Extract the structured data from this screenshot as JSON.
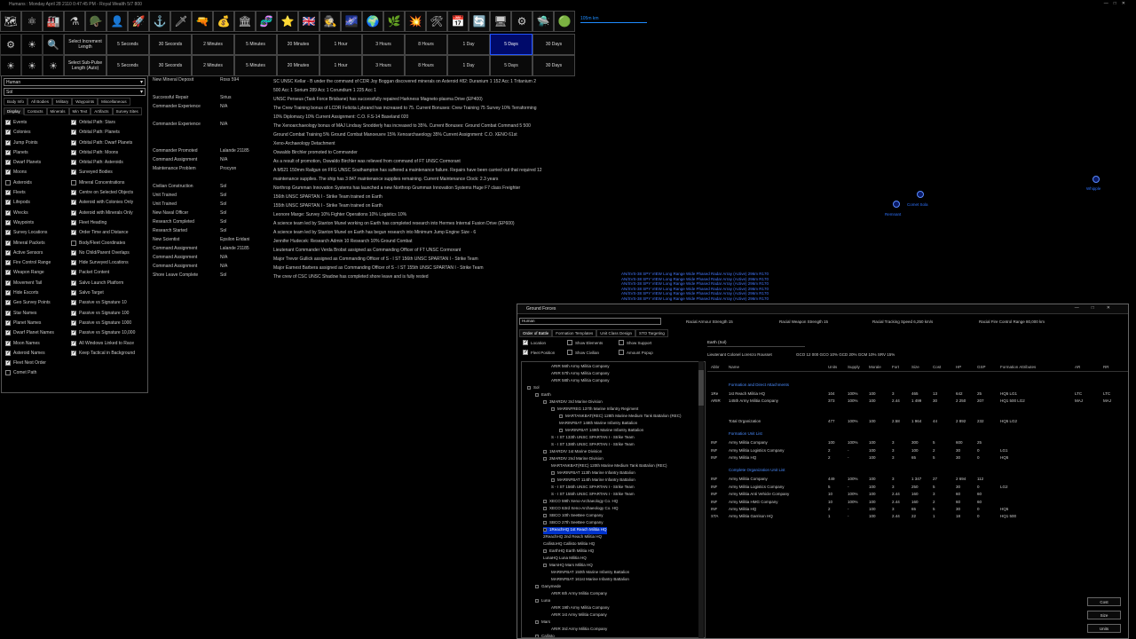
{
  "title": "Humans : Monday April 28 2110 0:47:45 PM - Royal Wealth 5/7 800",
  "window_controls": [
    "—",
    "□",
    "✕"
  ],
  "toolbar_icons": [
    "system-map-icon",
    "galaxy-icon",
    "production-icon",
    "research-icon",
    "ground-forces-icon",
    "commanders-icon",
    "ship-class-icon",
    "fleet-icon",
    "missile-icon",
    "turret-icon",
    "wealth-icon",
    "race-icon",
    "species-icon",
    "medal-icon",
    "nation-flag-icon",
    "intelligence-icon",
    "galaxy-view-icon",
    "survey-icon",
    "environment-icon",
    "combat-icon",
    "hull-icon",
    "events-icon",
    "refresh-icon",
    "tech-icon",
    "settings-icon",
    "ship-icon",
    "globe-icon"
  ],
  "toolbar_glyphs": [
    "🗺",
    "⚛",
    "🏭",
    "⚗",
    "🪖",
    "👤",
    "🚀",
    "⚓",
    "🗡",
    "🔫",
    "💰",
    "🏛",
    "🧬",
    "⭐",
    "🇬🇧",
    "🕵",
    "🌌",
    "🌍",
    "🌿",
    "💥",
    "🛠",
    "📅",
    "🔄",
    "🖥",
    "⚙",
    "🛸",
    "🟢"
  ],
  "scale_label": "105m km",
  "time_rows": [
    {
      "icons": [
        "⚙",
        "☀",
        "🔍"
      ],
      "select_label": "Select Increment Length",
      "buttons": [
        "5 Seconds",
        "30 Seconds",
        "2 Minutes",
        "5 Minutes",
        "20 Minutes",
        "1 Hour",
        "3 Hours",
        "8 Hours",
        "1 Day",
        "5 Days",
        "30 Days"
      ],
      "active_index": 9
    },
    {
      "icons": [
        "☀",
        "☀",
        "☀"
      ],
      "select_label": "Select Sub-Pulse Length (Auto)",
      "buttons": [
        "5 Seconds",
        "30 Seconds",
        "2 Minutes",
        "5 Minutes",
        "20 Minutes",
        "1 Hour",
        "3 Hours",
        "8 Hours",
        "1 Day",
        "5 Days",
        "30 Days"
      ],
      "active_index": -1
    }
  ],
  "left_panel": {
    "race_select": "Human",
    "system_select": "Sol",
    "tabs_row1": [
      "Body Info",
      "All Bodies",
      "Military",
      "Waypoints",
      "Miscellaneous"
    ],
    "tabs_row2": [
      "Display",
      "Contacts",
      "Minerals",
      "Min Text",
      "Artifacts",
      "Survey Sites"
    ],
    "checks_left": [
      {
        "label": "Events",
        "on": true
      },
      {
        "label": "Colonies",
        "on": true
      },
      {
        "label": "Jump Points",
        "on": true
      },
      {
        "label": "Planets",
        "on": true
      },
      {
        "label": "Dwarf Planets",
        "on": true
      },
      {
        "label": "Moons",
        "on": true
      },
      {
        "label": "Asteroids",
        "on": false
      },
      {
        "label": "Fleets",
        "on": true
      },
      {
        "label": "Lifepods",
        "on": true
      },
      {
        "label": "Wrecks",
        "on": true
      },
      {
        "label": "Waypoints",
        "on": true
      },
      {
        "label": "Survey Locations",
        "on": true
      },
      {
        "label": "Mineral Packets",
        "on": true
      },
      {
        "label": "Active Sensors",
        "on": true
      },
      {
        "label": "Fire Control Range",
        "on": true
      },
      {
        "label": "Weapon Range",
        "on": true
      },
      {
        "label": "Movement Tail",
        "on": true
      },
      {
        "label": "Hide Escorts",
        "on": true
      },
      {
        "label": "Geo Survey Points",
        "on": true
      },
      {
        "label": "Star Names",
        "on": true
      },
      {
        "label": "Planet Names",
        "on": true
      },
      {
        "label": "Dwarf Planet Names",
        "on": true
      },
      {
        "label": "Moon Names",
        "on": true
      },
      {
        "label": "Asteroid Names",
        "on": true
      },
      {
        "label": "Fleet Next Order",
        "on": true
      },
      {
        "label": "Comet Path",
        "on": false
      }
    ],
    "checks_right": [
      {
        "label": "Orbital Path: Stars",
        "on": true
      },
      {
        "label": "Orbital Path: Planets",
        "on": true
      },
      {
        "label": "Orbital Path: Dwarf Planets",
        "on": true
      },
      {
        "label": "Orbital Path: Moons",
        "on": true
      },
      {
        "label": "Orbital Path: Asteroids",
        "on": true
      },
      {
        "label": "Surveyed Bodies",
        "on": true
      },
      {
        "label": "Mineral Concentrations",
        "on": false
      },
      {
        "label": "Centre on Selected Objects",
        "on": true
      },
      {
        "label": "Asteroid with Colonies Only",
        "on": true
      },
      {
        "label": "Asteroid with Minerals Only",
        "on": true
      },
      {
        "label": "Fleet Heading",
        "on": true
      },
      {
        "label": "Order Time and Distance",
        "on": true
      },
      {
        "label": "Body/Fleet Coordinates",
        "on": false
      },
      {
        "label": "No Child/Parent Overlaps",
        "on": true
      },
      {
        "label": "Hide Surveyed Locations",
        "on": true
      },
      {
        "label": "Packet Content",
        "on": true
      },
      {
        "label": "Salvo Launch Platform",
        "on": true
      },
      {
        "label": "Salvo Target",
        "on": true
      },
      {
        "label": "Passive vs Signature 10",
        "on": true
      },
      {
        "label": "Passive vs Signature 100",
        "on": true
      },
      {
        "label": "Passive vs Signature 1000",
        "on": true
      },
      {
        "label": "Passive vs Signature 10,000",
        "on": true
      },
      {
        "label": "All Windows Linked to Race",
        "on": true
      },
      {
        "label": "Keep Tactical in Background",
        "on": true
      }
    ]
  },
  "events": [
    {
      "type": "New Mineral Deposit",
      "loc": "Ross 594",
      "lines": [
        "SC UNSC Kellar - B under the command of CDR Joy Boggan discovered minerals on Asteroid #82:  Duranium  1 152  Acc 1    Tritanium  2",
        "500  Acc 1    Sorium  289  Acc 1    Corundium  1 225  Acc 1"
      ]
    },
    {
      "type": "Successful Repair",
      "loc": "Sirius",
      "lines": [
        "UNSC Perseus (Task Force Brisbane) has successfully repaired Harkness Magneto-plasma Drive (EP400)"
      ]
    },
    {
      "type": "Commander Experience",
      "loc": "N/A",
      "lines": [
        "The Crew Training bonus of LCDR Felicita Lybrand has increased to 75.   Current Bonuses:  Crew Training 75    Survey 10%    Terraforming",
        "10%    Diplomacy 10%    Current Assignment:  C.O. F.S-14 Baseland 020"
      ]
    },
    {
      "type": "Commander Experience",
      "loc": "N/A",
      "lines": [
        "The Xenoarchaeology bonus of MAJ Lindsay Snodderly has increased to 35%.   Current Bonuses:  Ground Combat Command 5 500",
        "Ground Combat Training 5%    Ground Combat Manoeuvre 15%    Xenoarchaeology 35%    Current Assignment:  C.O. XENO 61st",
        "Xeno-Archaeology Detachment"
      ]
    },
    {
      "type": "Commander Promoted",
      "loc": "Lalande 21185",
      "lines": [
        "Oswaldo Birchler promoted to Commander"
      ]
    },
    {
      "type": "Command Assignment",
      "loc": "N/A",
      "lines": [
        "As a result of promotion, Oswaldo Birchler was relieved from command of FT UNSC Cormorant"
      ]
    },
    {
      "type": "Maintenance Problem",
      "loc": "Procyon",
      "lines": [
        "A M521 150mm Railgun on FFG UNSC Southampton has suffered a maintenance failure. Repairs have been carried out that required 12",
        "maintenance supplies. The ship has 3 847 maintenance supplies remaining. Current Maintenance Clock: 2.3 years"
      ]
    },
    {
      "type": "Civilian Construction",
      "loc": "Sol",
      "lines": [
        "Northrop Grumman Innovation Systems has launched a new Northrop Grumman Innovation Systems Huge F7 class Freighter"
      ]
    },
    {
      "type": "Unit Trained",
      "loc": "Sol",
      "lines": [
        "156th UNSC SPARTAN I - Strike Team trained on Earth"
      ]
    },
    {
      "type": "Unit Trained",
      "loc": "Sol",
      "lines": [
        "155th UNSC SPARTAN I - Strike Team trained on Earth"
      ]
    },
    {
      "type": "New Naval Officer",
      "loc": "Sol",
      "lines": [
        "Leonore Marge:  Survey 10%    Fighter Operations 10%    Logistics 10%"
      ]
    },
    {
      "type": "Research Completed",
      "loc": "Sol",
      "lines": [
        "A science team led by Stanton Munel working on Earth has completed research into Hermes Internal Fusion Drive  (EP600)"
      ]
    },
    {
      "type": "Research Started",
      "loc": "Sol",
      "lines": [
        "A science team led by Stanton Munel on Earth has begun research into Minimum Jump Engine Size - 6"
      ]
    },
    {
      "type": "New Scientist",
      "loc": "Epsilon Eridani",
      "lines": [
        "Jennifer Hudecek:  Research Admin 10    Research 10%    Ground Combat"
      ]
    },
    {
      "type": "Command Assignment",
      "loc": "Lalande 21185",
      "lines": [
        "Lieutenant Commander Verda Brobst assigned as Commanding Officer of FT UNSC Cormorant"
      ]
    },
    {
      "type": "Command Assignment",
      "loc": "N/A",
      "lines": [
        "Major Trevor Gullick assigned as Commanding Officer of S - I ST 156th UNSC SPARTAN I - Strike Team"
      ]
    },
    {
      "type": "Command Assignment",
      "loc": "N/A",
      "lines": [
        "Major Earnest Barbera assigned as Commanding Officer of S - I ST 155th UNSC SPARTAN I - Strike Team"
      ]
    },
    {
      "type": "Shore Leave Complete",
      "loc": "Sol",
      "lines": [
        "The crew of CSC UNSC Shadow has completed shore leave and is fully rested"
      ]
    }
  ],
  "map": {
    "bodies": [
      {
        "label": "Comet Sola"
      },
      {
        "label": "Remnant"
      },
      {
        "label": "Whipple"
      }
    ],
    "radar": [
      "AN/SVS-38 SPY VIEW Long Range Wide Phased Radar Array (Active)  296m  R170",
      "AN/SVS-38 SPY VIEW Long Range Wide Phased Radar Array (Active)  296m  R170",
      "AN/SVS-38 SPY VIEW Long Range Wide Phased Radar Array (Active)  296m  R170",
      "AN/SVS-38 SPY VIEW Long Range Wide Phased Radar Array (Active)  296m  R170",
      "AN/SVS-38 SPY VIEW Long Range Wide Phased Radar Array (Active)  296m  R170",
      "AN/SVS-38 SPY VIEW Long Range Wide Phased Radar Array (Active)  296m  R170"
    ]
  },
  "ground_forces": {
    "title": "Ground Forces",
    "race": "Human",
    "stats": [
      {
        "label": "Racial Armour Strength",
        "value": "15"
      },
      {
        "label": "Racial Weapon Strength",
        "value": "15"
      },
      {
        "label": "Racial Tracking Speed",
        "value": "6,250 km/s"
      },
      {
        "label": "Racial Fire Control Range",
        "value": "80,000 km"
      }
    ],
    "tabs": [
      "Order of Battle",
      "Formation Templates",
      "Unit Class Design",
      "STO Targeting"
    ],
    "options": [
      {
        "label": "Location",
        "on": true
      },
      {
        "label": "Show Elements",
        "on": false
      },
      {
        "label": "Show Support",
        "on": false
      },
      {
        "label": "Fleet Position",
        "on": true
      },
      {
        "label": "Show Civilian",
        "on": false
      },
      {
        "label": "Amount Popup",
        "on": false
      }
    ],
    "tree": [
      {
        "t": "ARIR 56th Army Militia Company",
        "d": 3
      },
      {
        "t": "ARIR 57th Army Militia Company",
        "d": 3
      },
      {
        "t": "ARIR 58th Army Militia Company",
        "d": 3
      },
      {
        "t": "Sol",
        "d": 0,
        "box": true
      },
      {
        "t": "Earth",
        "d": 1,
        "box": true
      },
      {
        "t": "3MARDIV 3rd Marine Division",
        "d": 2,
        "box": true
      },
      {
        "t": "MARINFREG 137th Marine Infantry Regiment",
        "d": 3,
        "box": true
      },
      {
        "t": "MARTANKBAT(REC) 128th Marine Medium Tank Battalion (REC)",
        "d": 4,
        "box": true
      },
      {
        "t": "MARINFBAT 148th Marine Infantry Battalion",
        "d": 4
      },
      {
        "t": "MARINFBAT 149th Marine Infantry Battalion",
        "d": 4,
        "box": true
      },
      {
        "t": "S - I ST 133th UNSC SPARTAN I - Strike Team",
        "d": 3
      },
      {
        "t": "S - I ST 138th UNSC SPARTAN I - Strike Team",
        "d": 3
      },
      {
        "t": "1MARDIV 1st Marine Division",
        "d": 2,
        "box": true
      },
      {
        "t": "2MARDIV 2nd Marine Division",
        "d": 2,
        "box": true
      },
      {
        "t": "MARTANKBAT(REC) 120th Marine Medium Tank Battalion (REC)",
        "d": 3
      },
      {
        "t": "MARINFBAT 113th Marine Infantry Battalion",
        "d": 3,
        "box": true
      },
      {
        "t": "MARINFBAT 114th Marine Infantry Battalion",
        "d": 3,
        "box": true
      },
      {
        "t": "S - I ST 156th UNSC SPARTAN I - Strike Team",
        "d": 3
      },
      {
        "t": "S - I ST 155th UNSC SPARTAN I - Strike Team",
        "d": 3
      },
      {
        "t": "XECO 59th Xeno-Archaeology Co. HQ",
        "d": 2,
        "box": true
      },
      {
        "t": "XECO 63rd Xeno-Archaeology Co. HQ",
        "d": 2,
        "box": true
      },
      {
        "t": "SBCO 10th SeeBee Company",
        "d": 2,
        "box": true
      },
      {
        "t": "SBCO 27th SeeBee Company",
        "d": 2,
        "box": true
      },
      {
        "t": "1ReachHQ 1st Reach Militia HQ",
        "d": 2,
        "box": true,
        "sel": true
      },
      {
        "t": "2ReachHQ 2nd Reach Militia HQ",
        "d": 2
      },
      {
        "t": "CallistoHQ Callisto Militia HQ",
        "d": 2
      },
      {
        "t": "EarthHQ Earth Militia HQ",
        "d": 2,
        "box": true
      },
      {
        "t": "LunaHQ Luna Militia HQ",
        "d": 2
      },
      {
        "t": "MarsHQ Mars Militia HQ",
        "d": 2,
        "box": true
      },
      {
        "t": "MARINFBAT 150th Marine Infantry Battalion",
        "d": 3
      },
      {
        "t": "MARINFBAT 161st Marine Infantry Battalion",
        "d": 3
      },
      {
        "t": "Ganymede",
        "d": 1,
        "box": true
      },
      {
        "t": "ARIR 6th Army Militia Company",
        "d": 3
      },
      {
        "t": "Luna",
        "d": 1,
        "box": true
      },
      {
        "t": "ARIR 19th Army Militia Company",
        "d": 3
      },
      {
        "t": "ARIR 1st Army Militia Company",
        "d": 3
      },
      {
        "t": "Mars",
        "d": 1,
        "box": true
      },
      {
        "t": "ARIR 3rd Army Militia Company",
        "d": 3
      },
      {
        "t": "Callisto",
        "d": 1,
        "box": true
      }
    ],
    "location": "Earth (Sol)",
    "commander": "Lieutenant Colonel Lorenzo Rousset",
    "commander_bonuses": [
      "GCO 12 000",
      "GCO 10%",
      "GCD 20%",
      "GCM 10%",
      "SRV 15%"
    ],
    "columns": [
      "Abbr",
      "Name",
      "Units",
      "Supply",
      "Morale",
      "Fort",
      "Size",
      "Cost",
      "HP",
      "GSP",
      "Formation Attributes",
      "AR",
      "RR"
    ],
    "sections": [
      {
        "title": "Formation and Direct Attachments",
        "rows": [
          [
            "1Re",
            "1st Reach Militia HQ",
            "104",
            "100%",
            "100",
            "3",
            "465",
            "13",
            "642",
            "25",
            "HQ5 LG1",
            "LTC",
            "LTC"
          ],
          [
            "ARIR",
            "145th Army Militia Company",
            "373",
            "100%",
            "100",
            "2.44",
            "1 499",
            "30",
            "2 250",
            "207",
            "HQ1 500 LG2",
            "MAJ",
            "MAJ"
          ]
        ]
      },
      {
        "title": "",
        "rows": [
          [
            "",
            "Total Organization",
            "477",
            "100%",
            "100",
            "2.58",
            "1 964",
            "44",
            "2 892",
            "232",
            "HQ5 LG2",
            "",
            ""
          ]
        ]
      },
      {
        "title": "Formation Unit List",
        "rows": [
          [
            "INF",
            "Army Militia Company",
            "100",
            "100%",
            "100",
            "3",
            "300",
            "5",
            "600",
            "25",
            "",
            "",
            ""
          ],
          [
            "INF",
            "Army Militia Logistics Company",
            "2",
            "-",
            "100",
            "3",
            "100",
            "2",
            "30",
            "0",
            "LG1",
            "",
            ""
          ],
          [
            "INF",
            "Army Militia HQ",
            "2",
            "-",
            "100",
            "3",
            "65",
            "5",
            "30",
            "0",
            "HQ5",
            "",
            ""
          ]
        ]
      },
      {
        "title": "Complete Organization Unit List",
        "rows": [
          [
            "INF",
            "Army Militia Company",
            "449",
            "100%",
            "100",
            "3",
            "1 347",
            "27",
            "2 694",
            "112",
            "",
            "",
            ""
          ],
          [
            "INF",
            "Army Militia Logistics Company",
            "5",
            "-",
            "100",
            "3",
            "250",
            "5",
            "30",
            "0",
            "LG2",
            "",
            ""
          ],
          [
            "INF",
            "Army Militia Anti Vehicle Company",
            "10",
            "100%",
            "100",
            "2.44",
            "160",
            "3",
            "60",
            "60",
            "",
            "",
            ""
          ],
          [
            "INF",
            "Army Militia HMG Company",
            "10",
            "100%",
            "100",
            "2.44",
            "160",
            "2",
            "60",
            "60",
            "",
            "",
            ""
          ],
          [
            "INF",
            "Army Militia HQ",
            "2",
            "-",
            "100",
            "3",
            "65",
            "5",
            "30",
            "0",
            "HQ5",
            "",
            ""
          ],
          [
            "STA",
            "Army Militia Garrison HQ",
            "1",
            "-",
            "100",
            "2.44",
            "22",
            "1",
            "18",
            "0",
            "HQ1 500",
            "",
            ""
          ]
        ]
      }
    ],
    "buttons": [
      "Cost",
      "Size",
      "Units"
    ]
  }
}
